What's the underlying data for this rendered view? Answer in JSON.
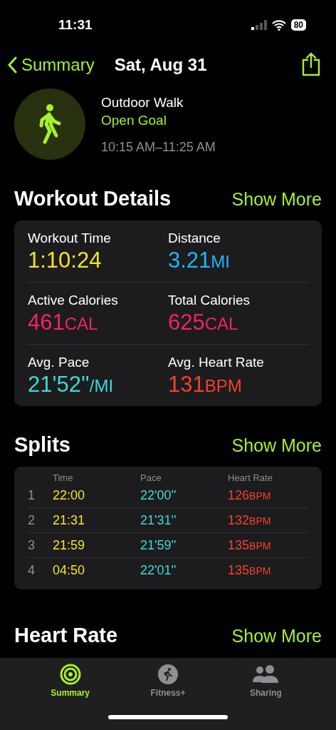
{
  "status_bar": {
    "time": "11:31",
    "battery": "80"
  },
  "nav": {
    "back": "Summary",
    "title": "Sat, Aug 31"
  },
  "workout": {
    "name": "Outdoor Walk",
    "goal": "Open Goal",
    "time_range": "10:15 AM–11:25 AM"
  },
  "details": {
    "title": "Workout Details",
    "action": "Show More",
    "metrics": [
      {
        "label": "Workout Time",
        "value": "1:10:24",
        "color": "#f5e12b"
      },
      {
        "label": "Distance",
        "value": "3.21",
        "unit": "MI",
        "color": "#1fb6f5"
      },
      {
        "label": "Active Calories",
        "value": "461",
        "unit": "CAL",
        "color": "#f5245a"
      },
      {
        "label": "Total Calories",
        "value": "625",
        "unit": "CAL",
        "color": "#f5245a"
      },
      {
        "label": "Avg. Pace",
        "value": "21'52''",
        "unit": "/MI",
        "color": "#3fd8d8"
      },
      {
        "label": "Avg. Heart Rate",
        "value": "131",
        "unit": "BPM",
        "color": "#f5402c"
      }
    ]
  },
  "splits": {
    "title": "Splits",
    "action": "Show More",
    "columns": [
      "Time",
      "Pace",
      "Heart Rate"
    ],
    "rows": [
      {
        "index": "1",
        "time": "22:00",
        "pace": "22'00''",
        "heart_rate": "126",
        "unit": "BPM"
      },
      {
        "index": "2",
        "time": "21:31",
        "pace": "21'31''",
        "heart_rate": "132",
        "unit": "BPM"
      },
      {
        "index": "3",
        "time": "21:59",
        "pace": "21'59''",
        "heart_rate": "135",
        "unit": "BPM"
      },
      {
        "index": "4",
        "time": "04:50",
        "pace": "22'01''",
        "heart_rate": "135",
        "unit": "BPM"
      }
    ]
  },
  "heart_rate": {
    "title": "Heart Rate",
    "action": "Show More"
  },
  "tabs": [
    {
      "label": "Summary",
      "selected": true,
      "kind": "rings"
    },
    {
      "label": "Fitness+",
      "selected": false,
      "kind": "runner"
    },
    {
      "label": "Sharing",
      "selected": false,
      "kind": "people"
    }
  ]
}
